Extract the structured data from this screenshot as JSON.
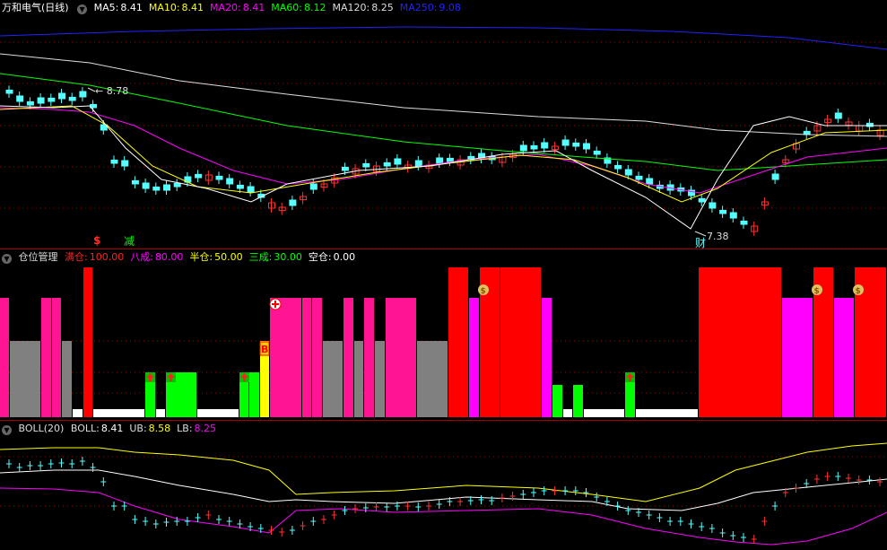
{
  "main": {
    "stock_title": "万和电气(日线)",
    "ma": [
      {
        "label": "MA5:",
        "value": "8.41",
        "color": "#ffffff"
      },
      {
        "label": "MA10:",
        "value": "8.41",
        "color": "#ffff00"
      },
      {
        "label": "MA20:",
        "value": "8.41",
        "color": "#ff00ff"
      },
      {
        "label": "MA60:",
        "value": "8.12",
        "color": "#00ff00"
      },
      {
        "label": "MA120:",
        "value": "8.25",
        "color": "#dddddd"
      },
      {
        "label": "MA250:",
        "value": "9.08",
        "color": "#2222ff"
      }
    ],
    "high_label": "8.78",
    "low_label": "7.38",
    "signal_s": "$",
    "signal_jian": "减",
    "signal_cai": "财"
  },
  "position": {
    "title": "仓位管理",
    "legend": [
      {
        "label": "满仓:",
        "value": "100.00",
        "color": "#ff2020"
      },
      {
        "label": "八成:",
        "value": "80.00",
        "color": "#ff00ff"
      },
      {
        "label": "半仓:",
        "value": "50.00",
        "color": "#ffff00"
      },
      {
        "label": "三成:",
        "value": "30.00",
        "color": "#00ff00"
      },
      {
        "label": "空仓:",
        "value": "0.00",
        "color": "#ffffff"
      }
    ],
    "b_marker": "B",
    "money_icon": "money-bag-icon",
    "arrow_icon": "up-arrow-icon"
  },
  "boll": {
    "title": "BOLL(20)",
    "items": [
      {
        "label": "BOLL:",
        "value": "8.41",
        "color": "#ffffff"
      },
      {
        "label": "UB:",
        "value": "8.58",
        "color": "#ffff00"
      },
      {
        "label": "LB:",
        "value": "8.25",
        "color": "#ff00ff"
      }
    ]
  },
  "colors": {
    "bg": "#000000",
    "up": "#ff3232",
    "down": "#54ffff",
    "full": "#ff0000",
    "eighty": "#ff1493",
    "magenta": "#ff00ff",
    "half": "#ffff00",
    "thirty": "#00ff00",
    "empty": "#ffffff",
    "gray": "#808080"
  }
}
